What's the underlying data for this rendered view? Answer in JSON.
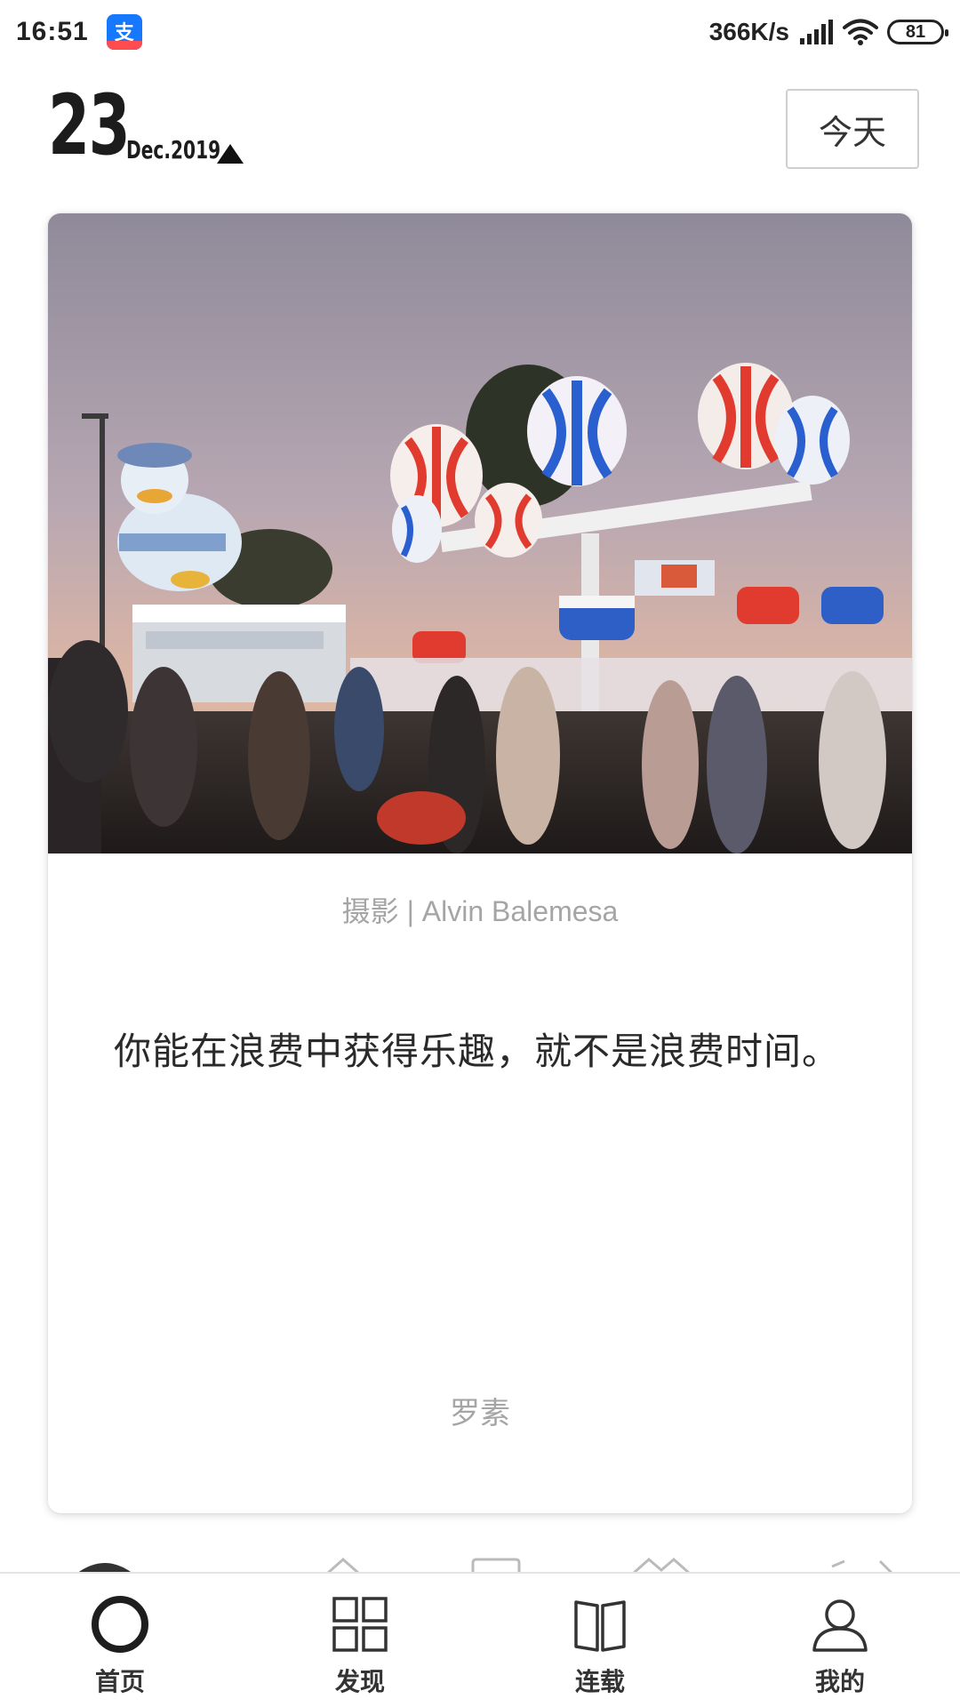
{
  "status_bar": {
    "time": "16:51",
    "net_speed": "366K/s",
    "battery_level": "81",
    "app_icon": "alipay-icon"
  },
  "date_header": {
    "day": "23",
    "month_year": "Dec.2019",
    "toggle_icon": "triangle-up-icon",
    "today_label": "今天"
  },
  "card": {
    "photo_credit": "摄影 | Alvin Balemesa",
    "quote": "你能在浪费中获得乐趣，就不是浪费时间。",
    "author": "罗素"
  },
  "bottom_nav": {
    "items": [
      {
        "label": "首页",
        "icon": "home-ring-icon",
        "active": true
      },
      {
        "label": "发现",
        "icon": "grid-icon",
        "active": false
      },
      {
        "label": "连载",
        "icon": "book-icon",
        "active": false
      },
      {
        "label": "我的",
        "icon": "user-icon",
        "active": false
      }
    ]
  },
  "colors": {
    "text_primary": "#222222",
    "text_muted": "#a5a5a5",
    "alipay_blue": "#1677ff"
  }
}
